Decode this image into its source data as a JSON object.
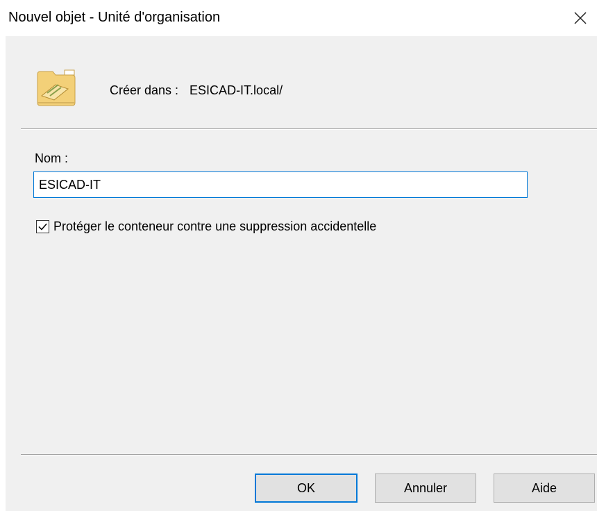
{
  "window": {
    "title": "Nouvel objet - Unité d'organisation",
    "close_icon": "close-icon"
  },
  "header": {
    "icon": "organizational-unit-folder-icon",
    "create_label": "Créer dans :",
    "create_path": "ESICAD-IT.local/"
  },
  "form": {
    "name_label": "Nom :",
    "name_value": "ESICAD-IT",
    "protect_checked": true,
    "protect_label": "Protéger le conteneur contre une suppression accidentelle"
  },
  "buttons": {
    "ok": "OK",
    "cancel": "Annuler",
    "help": "Aide"
  },
  "colors": {
    "accent": "#0078d7",
    "dialog_background": "#f0f0f0",
    "button_face": "#e1e1e1"
  }
}
